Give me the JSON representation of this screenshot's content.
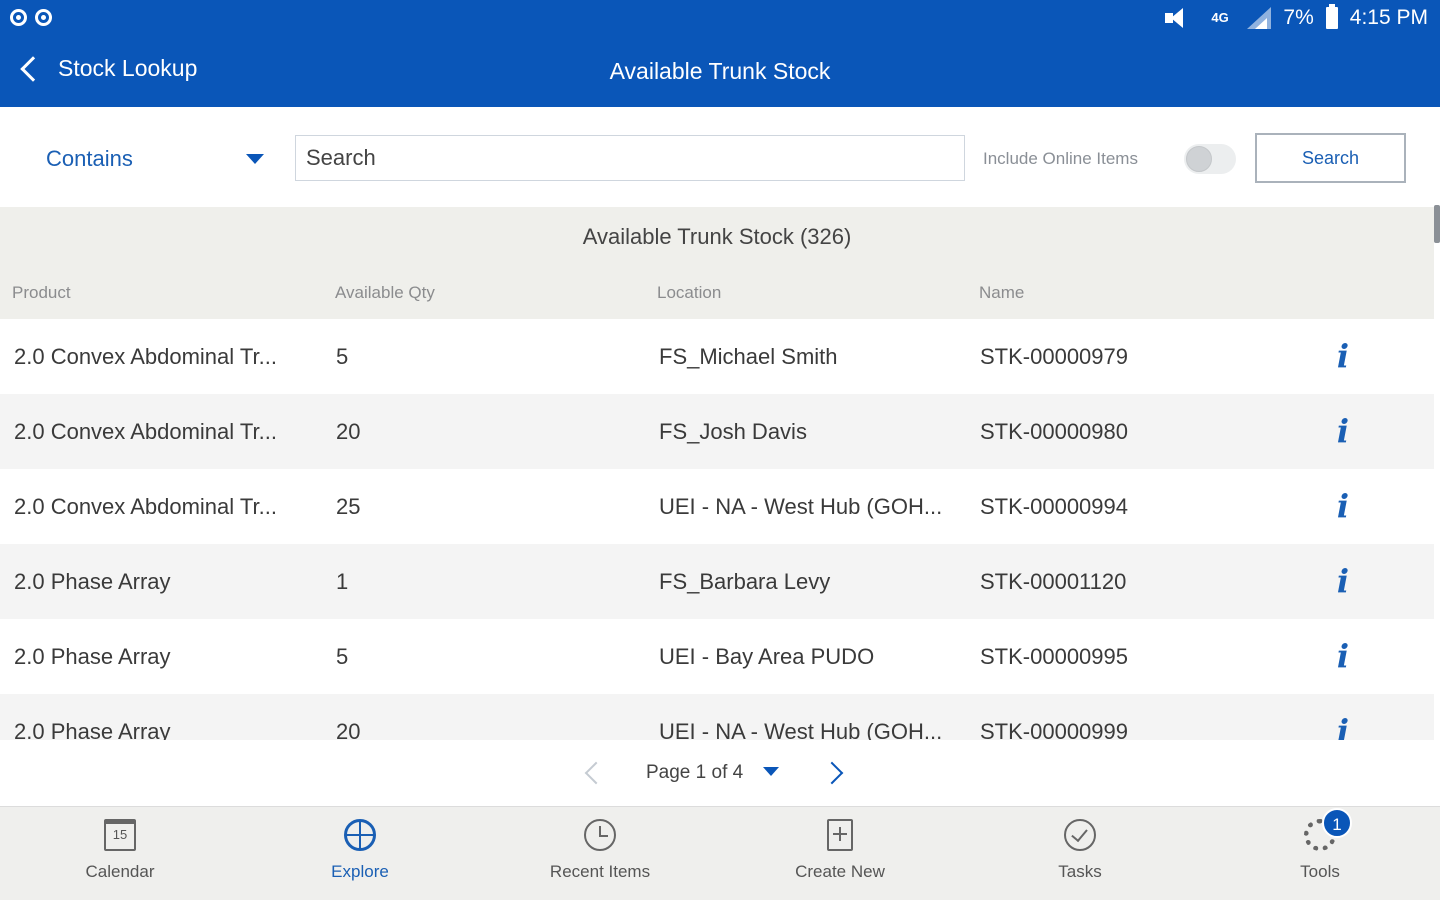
{
  "status_bar": {
    "battery": "7%",
    "time": "4:15 PM",
    "data_indicator": "4G"
  },
  "header": {
    "back_label": "Stock Lookup",
    "title": "Available Trunk Stock"
  },
  "filter": {
    "mode": "Contains",
    "search_placeholder": "Search",
    "include_online_label": "Include Online Items",
    "include_online_enabled": false,
    "search_button": "Search"
  },
  "table": {
    "caption": "Available Trunk Stock (326)",
    "columns": [
      "Product",
      "Available Qty",
      "Location",
      "Name"
    ],
    "rows": [
      {
        "product": "2.0 Convex Abdominal Tr...",
        "qty": "5",
        "location": "FS_Michael Smith",
        "name": "STK-00000979"
      },
      {
        "product": "2.0 Convex Abdominal Tr...",
        "qty": "20",
        "location": "FS_Josh Davis",
        "name": "STK-00000980"
      },
      {
        "product": "2.0 Convex Abdominal Tr...",
        "qty": "25",
        "location": "UEI - NA - West Hub (GOH...",
        "name": "STK-00000994"
      },
      {
        "product": "2.0 Phase Array",
        "qty": "1",
        "location": "FS_Barbara Levy",
        "name": "STK-00001120"
      },
      {
        "product": "2.0 Phase Array",
        "qty": "5",
        "location": "UEI - Bay Area PUDO",
        "name": "STK-00000995"
      },
      {
        "product": "2.0 Phase Array",
        "qty": "20",
        "location": "UEI - NA - West Hub (GOH...",
        "name": "STK-00000999"
      }
    ],
    "info_icon": "i"
  },
  "pager": {
    "label": "Page 1 of 4"
  },
  "tabs": [
    {
      "label": "Calendar",
      "icon": "calendar-icon",
      "icon_text": "15"
    },
    {
      "label": "Explore",
      "icon": "globe-icon",
      "active": true
    },
    {
      "label": "Recent Items",
      "icon": "recent-icon"
    },
    {
      "label": "Create New",
      "icon": "create-icon"
    },
    {
      "label": "Tasks",
      "icon": "tasks-icon"
    },
    {
      "label": "Tools",
      "icon": "gear-icon",
      "badge": "1"
    }
  ],
  "colors": {
    "brand": "#0a56b8",
    "link": "#1a5fb4",
    "table_header_bg": "#efefeb"
  }
}
